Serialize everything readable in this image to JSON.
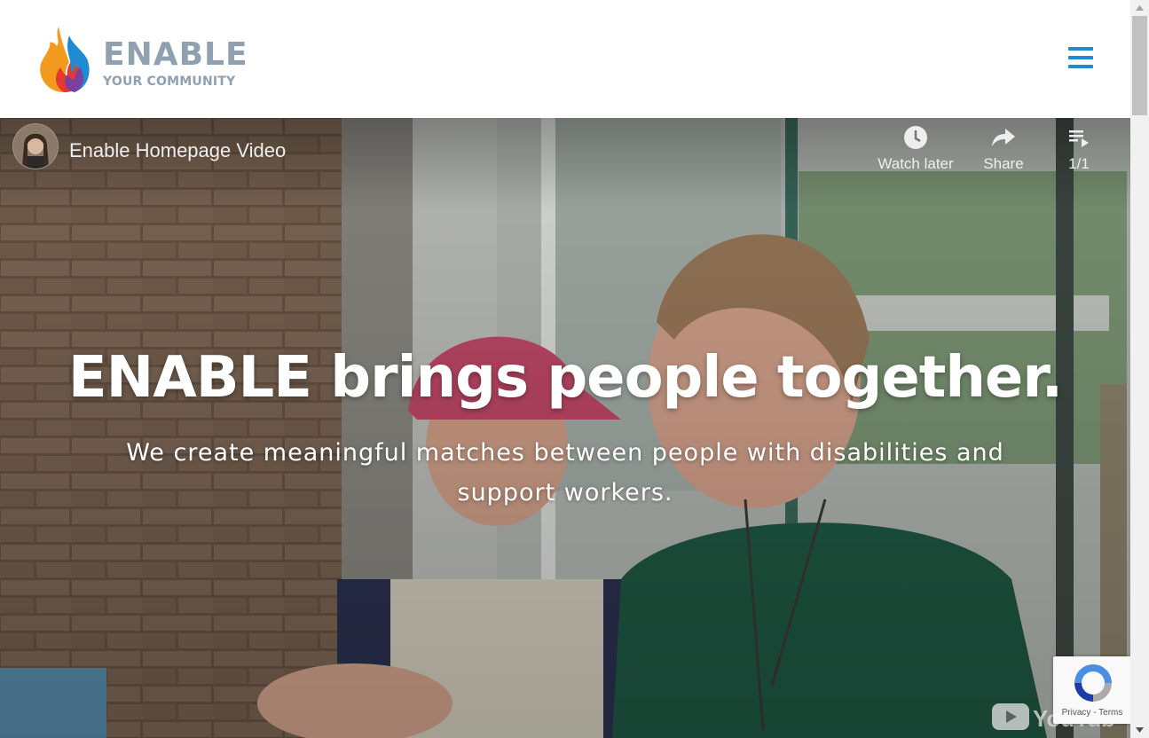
{
  "header": {
    "logo_title": "ENABLE",
    "logo_subtitle": "YOUR COMMUNITY",
    "menu_icon": "hamburger-menu-icon"
  },
  "video": {
    "title": "Enable Homepage Video",
    "actions": [
      {
        "label": "Watch later",
        "icon": "clock-icon"
      },
      {
        "label": "Share",
        "icon": "share-arrow-icon"
      },
      {
        "label": "1/1",
        "icon": "playlist-icon"
      }
    ],
    "watermark": "YouTube"
  },
  "hero": {
    "headline": "ENABLE brings people together.",
    "subline": "We create meaningful matches between people with disabilities and support workers."
  },
  "recaptcha": {
    "privacy": "Privacy",
    "separator": " - ",
    "terms": "Terms"
  },
  "colors": {
    "brand_blue": "#1f8bd2",
    "logo_gray": "#8fa0b0"
  }
}
